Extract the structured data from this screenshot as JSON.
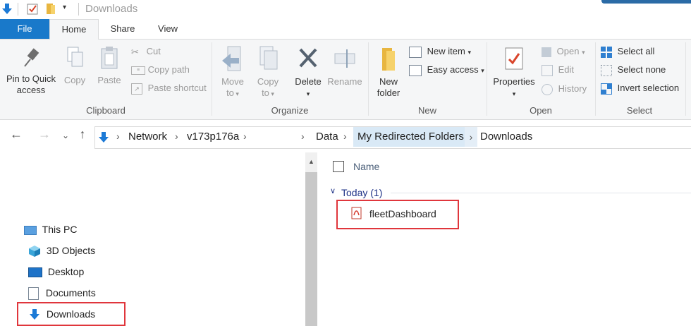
{
  "window": {
    "title": "Downloads"
  },
  "tabs": [
    {
      "label": "File"
    },
    {
      "label": "Home"
    },
    {
      "label": "Share"
    },
    {
      "label": "View"
    }
  ],
  "ribbon": {
    "clipboard": {
      "group_label": "Clipboard",
      "pin_label_1": "Pin to Quick",
      "pin_label_2": "access",
      "copy_label": "Copy",
      "paste_label": "Paste",
      "cut_label": "Cut",
      "copy_path_label": "Copy path",
      "paste_shortcut_label": "Paste shortcut"
    },
    "organize": {
      "group_label": "Organize",
      "move_label_1": "Move",
      "move_label_2": "to",
      "copy_label_1": "Copy",
      "copy_label_2": "to",
      "delete_label": "Delete",
      "rename_label": "Rename"
    },
    "new": {
      "group_label": "New",
      "new_folder_label_1": "New",
      "new_folder_label_2": "folder",
      "new_item_label": "New item",
      "easy_access_label": "Easy access"
    },
    "open": {
      "group_label": "Open",
      "properties_label": "Properties",
      "open_label": "Open",
      "edit_label": "Edit",
      "history_label": "History"
    },
    "select": {
      "group_label": "Select",
      "select_all_label": "Select all",
      "select_none_label": "Select none",
      "invert_label": "Invert selection"
    }
  },
  "address": {
    "crumbs": [
      "Network",
      "v173p176a",
      "Data",
      "My Redirected Folders",
      "Downloads"
    ]
  },
  "navpane": {
    "items": [
      {
        "label": "This PC",
        "icon": "computer-icon"
      },
      {
        "label": "3D Objects",
        "icon": "cube-icon"
      },
      {
        "label": "Desktop",
        "icon": "desktop-icon"
      },
      {
        "label": "Documents",
        "icon": "document-icon"
      },
      {
        "label": "Downloads",
        "icon": "download-arrow-icon"
      }
    ]
  },
  "content": {
    "column_name": "Name",
    "group_header": "Today (1)",
    "files": [
      {
        "name": "fleetDashboard",
        "icon": "pdf-icon"
      }
    ]
  },
  "colors": {
    "accent": "#1979ca",
    "highlight_box": "#e0363c",
    "crumb_highlight": "#d9e9f6"
  }
}
